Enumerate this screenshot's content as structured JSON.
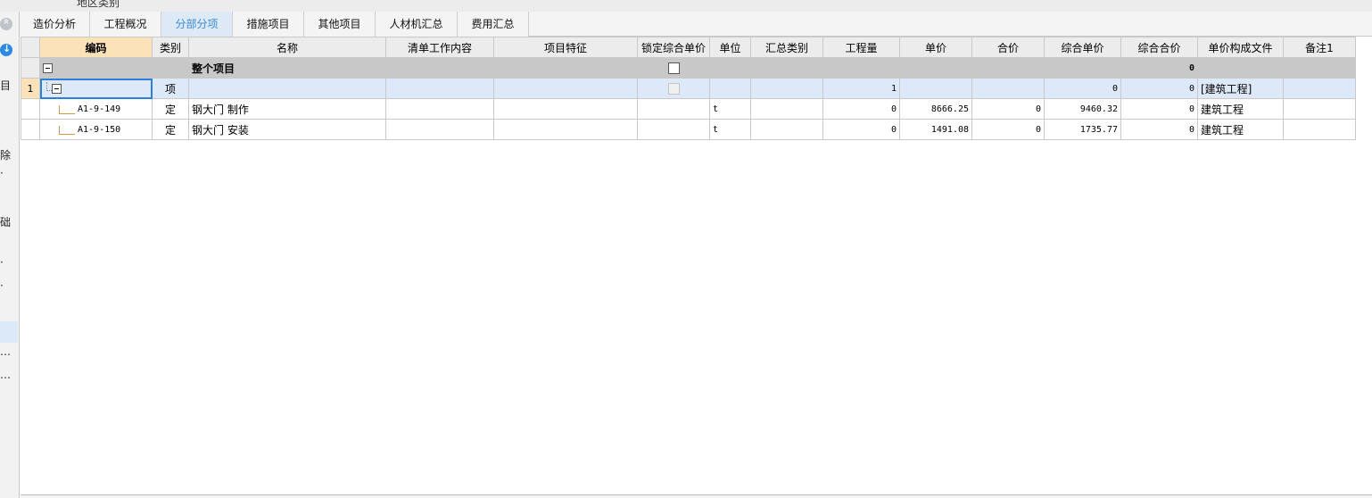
{
  "top_fragment": "地区类别",
  "left_fragments": [
    "目",
    "除",
    "·",
    "础",
    "·",
    "·",
    "…",
    "…"
  ],
  "tabs": [
    {
      "label": "造价分析",
      "active": false
    },
    {
      "label": "工程概况",
      "active": false
    },
    {
      "label": "分部分项",
      "active": true
    },
    {
      "label": "措施项目",
      "active": false
    },
    {
      "label": "其他项目",
      "active": false
    },
    {
      "label": "人材机汇总",
      "active": false
    },
    {
      "label": "费用汇总",
      "active": false
    }
  ],
  "columns": [
    "编码",
    "类别",
    "名称",
    "清单工作内容",
    "项目特征",
    "锁定综合单价",
    "单位",
    "汇总类别",
    "工程量",
    "单价",
    "合价",
    "综合单价",
    "综合合价",
    "单价构成文件",
    "备注1"
  ],
  "rows": [
    {
      "rownum": "",
      "code": "",
      "type": "",
      "name": "整个项目",
      "unit": "",
      "qty": "",
      "price": "",
      "total": "",
      "comp_price": "",
      "comp_total": "0",
      "template": ""
    },
    {
      "rownum": "1",
      "code": "",
      "type": "项",
      "name": "",
      "unit": "",
      "qty": "1",
      "price": "",
      "total": "",
      "comp_price": "0",
      "comp_total": "0",
      "template": "[建筑工程]"
    },
    {
      "rownum": "",
      "code": "A1-9-149",
      "type": "定",
      "name": "钢大门 制作",
      "unit": "t",
      "qty": "0",
      "price": "8666.25",
      "total": "0",
      "comp_price": "9460.32",
      "comp_total": "0",
      "template": "建筑工程"
    },
    {
      "rownum": "",
      "code": "A1-9-150",
      "type": "定",
      "name": "钢大门 安装",
      "unit": "t",
      "qty": "0",
      "price": "1491.08",
      "total": "0",
      "comp_price": "1735.77",
      "comp_total": "0",
      "template": "建筑工程"
    }
  ],
  "colors": {
    "active_tab_text": "#3b8ad8",
    "selected_header": "#fbe2b8",
    "root_row": "#c8c8c8",
    "selected_row": "#dde9f8"
  }
}
